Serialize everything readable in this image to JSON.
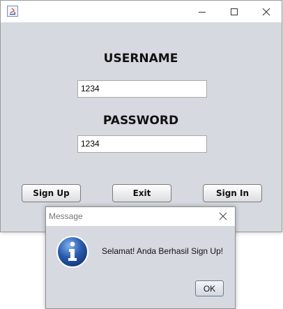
{
  "window": {
    "controls": {
      "minimize": "minimize-icon",
      "maximize": "maximize-icon",
      "close": "close-icon"
    }
  },
  "form": {
    "username_label": "USERNAME",
    "username_value": "1234",
    "password_label": "PASSWORD",
    "password_value": "1234"
  },
  "buttons": {
    "signup": "Sign Up",
    "exit": "Exit",
    "signin": "Sign In"
  },
  "dialog": {
    "title": "Message",
    "message": "Selamat! Anda Berhasil Sign Up!",
    "ok": "OK",
    "icon": "info-icon"
  },
  "colors": {
    "window_bg": "#d6d9df",
    "titlebar_bg": "#ffffff",
    "info_icon_blue": "#2a5cad"
  }
}
